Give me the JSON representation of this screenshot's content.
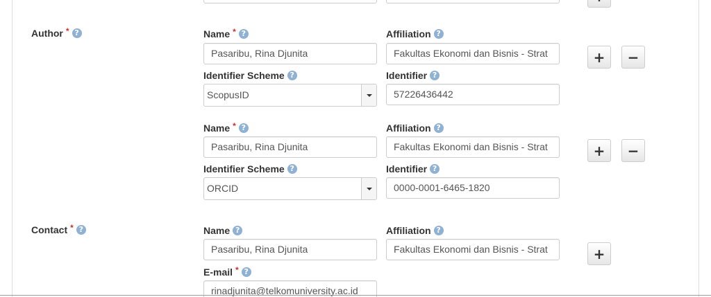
{
  "author": {
    "label": "Author",
    "entries": [
      {
        "name_label": "Name",
        "name_value": "Pasaribu, Rina Djunita",
        "affiliation_label": "Affiliation",
        "affiliation_value": "Fakultas Ekonomi dan Bisnis - Strat",
        "scheme_label": "Identifier Scheme",
        "scheme_value": "ScopusID",
        "identifier_label": "Identifier",
        "identifier_value": "57226436442"
      },
      {
        "name_label": "Name",
        "name_value": "Pasaribu, Rina Djunita",
        "affiliation_label": "Affiliation",
        "affiliation_value": "Fakultas Ekonomi dan Bisnis - Strat",
        "scheme_label": "Identifier Scheme",
        "scheme_value": "ORCID",
        "identifier_label": "Identifier",
        "identifier_value": "0000-0001-6465-1820"
      }
    ]
  },
  "contact": {
    "label": "Contact",
    "name_label": "Name",
    "name_value": "Pasaribu, Rina Djunita",
    "affiliation_label": "Affiliation",
    "affiliation_value": "Fakultas Ekonomi dan Bisnis - Strat",
    "email_label": "E-mail",
    "email_value": "rinadjunita@telkomuniversity.ac.id"
  },
  "controls": {
    "required_mark": "*",
    "help_glyph": "?",
    "add_glyph": "+",
    "remove_glyph": "−"
  },
  "colors": {
    "required": "#c9302c",
    "help_icon": "#8fb1d3"
  }
}
